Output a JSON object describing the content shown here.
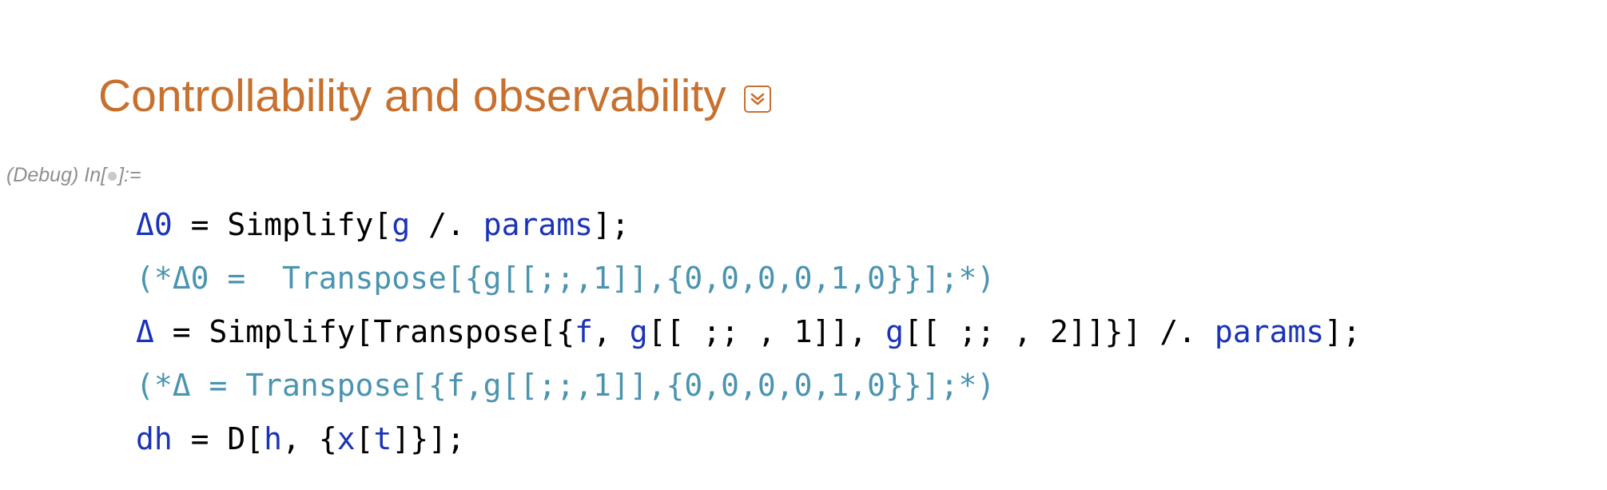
{
  "section": {
    "title": "Controllability and observability",
    "collapse_icon": "double-chevron-down-icon",
    "color": "#c8702e"
  },
  "cell": {
    "label_prefix": "(Debug) In[",
    "label_suffix": "]:="
  },
  "colors": {
    "symbol": "#1a33b8",
    "comment": "#4a94b0",
    "builtin": "#000000"
  },
  "code_lines": [
    {
      "tokens": [
        {
          "t": "Δ0",
          "c": "v"
        },
        {
          "t": " = ",
          "c": "k"
        },
        {
          "t": "Simplify[",
          "c": "k"
        },
        {
          "t": "g",
          "c": "v"
        },
        {
          "t": " /. ",
          "c": "k"
        },
        {
          "t": "params",
          "c": "v"
        },
        {
          "t": "];",
          "c": "k"
        }
      ]
    },
    {
      "tokens": [
        {
          "t": "(*Δ0 =  Transpose[{g[[;;,1]],{0,0,0,0,1,0}}];*)",
          "c": "c"
        }
      ]
    },
    {
      "tokens": [
        {
          "t": "Δ",
          "c": "v"
        },
        {
          "t": " = ",
          "c": "k"
        },
        {
          "t": "Simplify[Transpose[{",
          "c": "k"
        },
        {
          "t": "f",
          "c": "v"
        },
        {
          "t": ", ",
          "c": "k"
        },
        {
          "t": "g",
          "c": "v"
        },
        {
          "t": "[[ ;; , 1]], ",
          "c": "k"
        },
        {
          "t": "g",
          "c": "v"
        },
        {
          "t": "[[ ;; , 2]]}] /. ",
          "c": "k"
        },
        {
          "t": "params",
          "c": "v"
        },
        {
          "t": "];",
          "c": "k"
        }
      ]
    },
    {
      "tokens": [
        {
          "t": "(*Δ = Transpose[{f,g[[;;,1]],{0,0,0,0,1,0}}];*)",
          "c": "c"
        }
      ]
    },
    {
      "tokens": [
        {
          "t": "dh",
          "c": "v"
        },
        {
          "t": " = ",
          "c": "k"
        },
        {
          "t": "D[",
          "c": "k"
        },
        {
          "t": "h",
          "c": "v"
        },
        {
          "t": ", {",
          "c": "k"
        },
        {
          "t": "x",
          "c": "v"
        },
        {
          "t": "[",
          "c": "k"
        },
        {
          "t": "t",
          "c": "v"
        },
        {
          "t": "]}];",
          "c": "k"
        }
      ]
    }
  ]
}
